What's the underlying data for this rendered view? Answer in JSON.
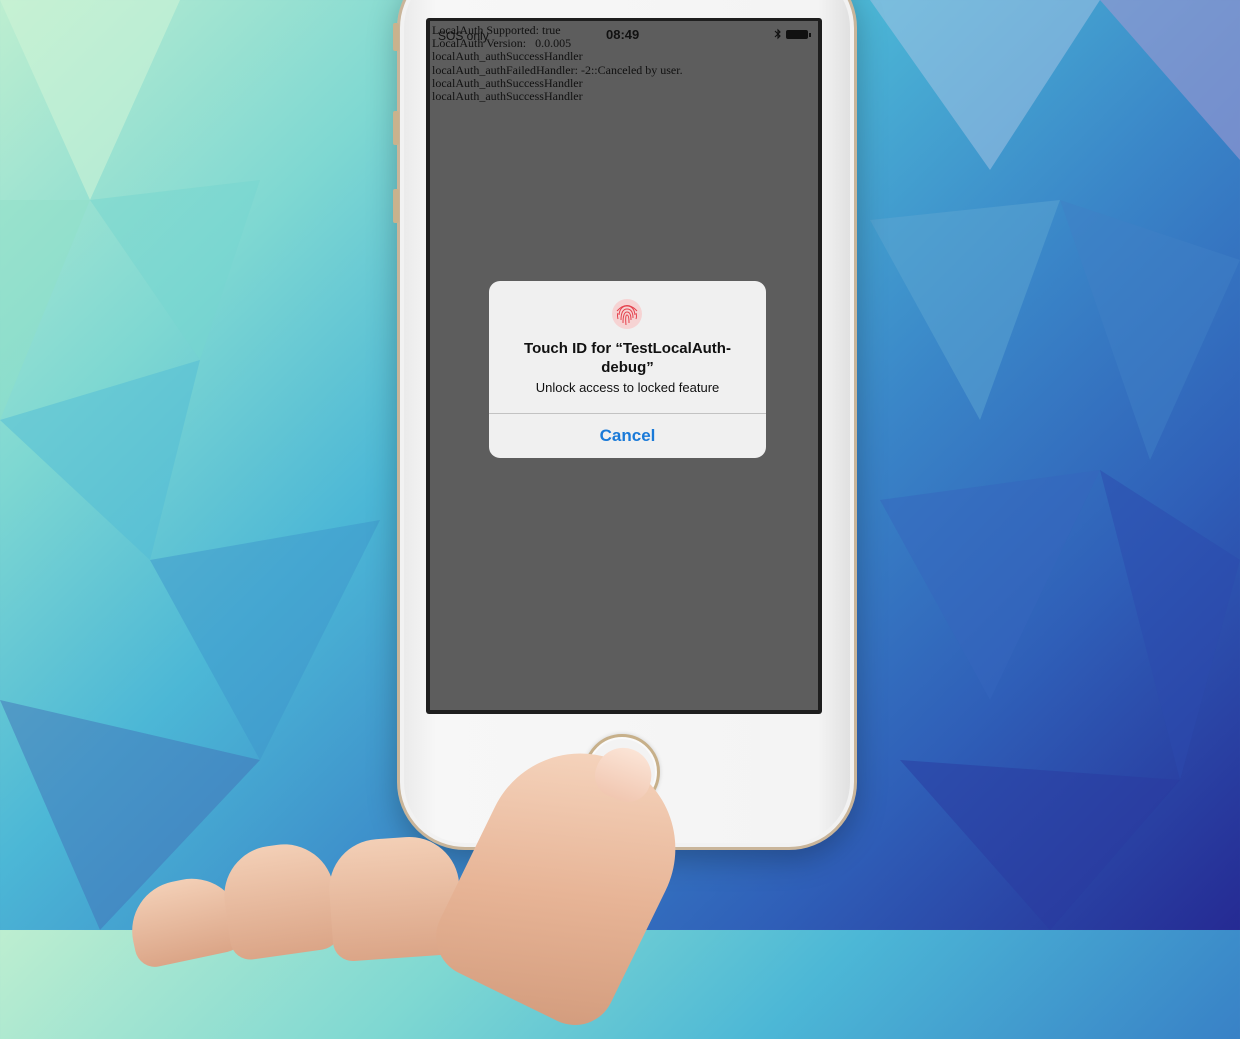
{
  "status_bar": {
    "carrier": "SOS only",
    "time": "08:49",
    "icons": [
      "bluetooth-icon",
      "battery-icon"
    ]
  },
  "console_log": [
    "LocalAuth Supported: true",
    "LocalAuth Version:   0.0.005",
    "localAuth_authSuccessHandler",
    "localAuth_authFailedHandler: -2::Canceled by user.",
    "localAuth_authSuccessHandler",
    "localAuth_authSuccessHandler"
  ],
  "touch_id_dialog": {
    "icon": "fingerprint-icon",
    "title": "Touch ID for “TestLocalAuth-debug”",
    "message": "Unlock access to locked feature",
    "cancel_label": "Cancel",
    "accent_color": "#1a7ad8"
  }
}
